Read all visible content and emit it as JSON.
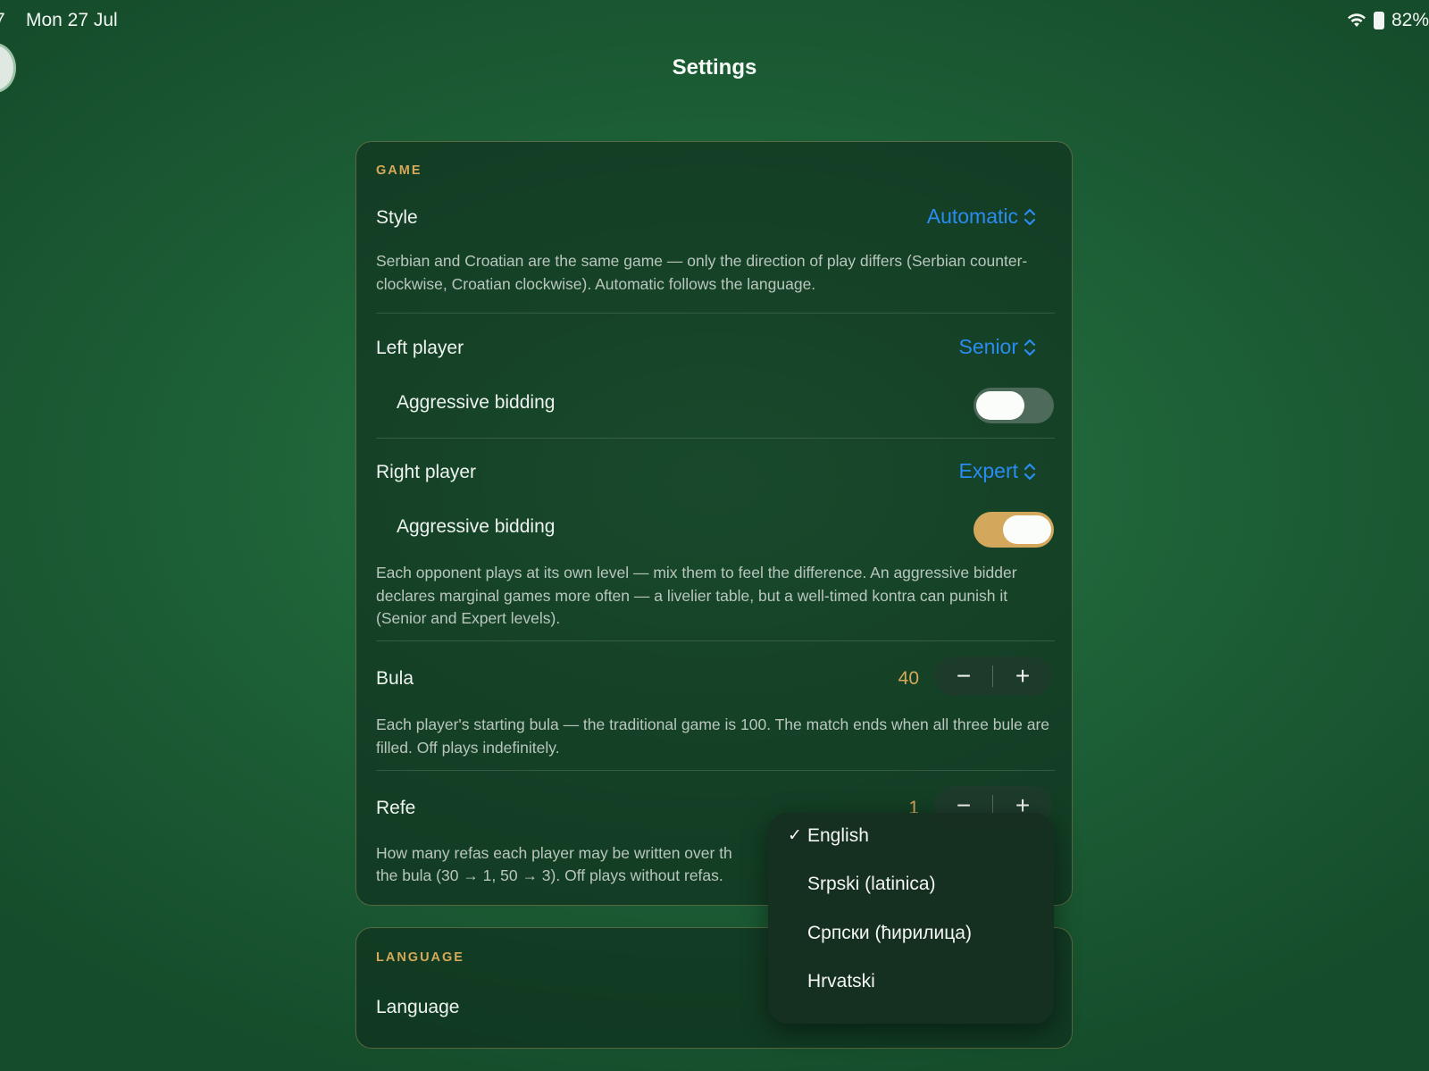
{
  "status_bar": {
    "time": "7",
    "date": "Mon 27 Jul",
    "battery": "82%"
  },
  "page": {
    "title": "Settings"
  },
  "game": {
    "header": "GAME",
    "style": {
      "label": "Style",
      "value": "Automatic",
      "desc": "Serbian and Croatian are the same game — only the direction of play differs (Serbian counter-clockwise, Croatian clockwise). Automatic follows the language."
    },
    "left_player": {
      "label": "Left player",
      "value": "Senior",
      "aggressive_label": "Aggressive bidding",
      "aggressive_on": false
    },
    "right_player": {
      "label": "Right player",
      "value": "Expert",
      "aggressive_label": "Aggressive bidding",
      "aggressive_on": true
    },
    "players_desc": "Each opponent plays at its own level — mix them to feel the difference. An aggressive bidder declares marginal games more often — a livelier table, but a well-timed kontra can punish it (Senior and Expert levels).",
    "bula": {
      "label": "Bula",
      "value": "40",
      "desc": "Each player's starting bula — the traditional game is 100. The match ends when all three bule are filled. Off plays indefinitely."
    },
    "refe": {
      "label": "Refe",
      "value": "1",
      "desc_line1": "How many refas each player may be written over th",
      "desc_line2": "the bula (30 → 1, 50 → 3). Off plays without refas."
    }
  },
  "language_section": {
    "header": "LANGUAGE",
    "label": "Language"
  },
  "language_menu": {
    "items": [
      {
        "label": "English",
        "selected": true
      },
      {
        "label": "Srpski (latinica)",
        "selected": false
      },
      {
        "label": "Српски (ћирилица)",
        "selected": false
      },
      {
        "label": "Hrvatski",
        "selected": false
      }
    ]
  },
  "colors": {
    "accent_blue": "#2a8cf0",
    "accent_gold": "#d6a85a",
    "background_green": "#1e6238"
  },
  "icons": {
    "stepper_minus": "−",
    "stepper_plus": "+",
    "check": "✓"
  }
}
